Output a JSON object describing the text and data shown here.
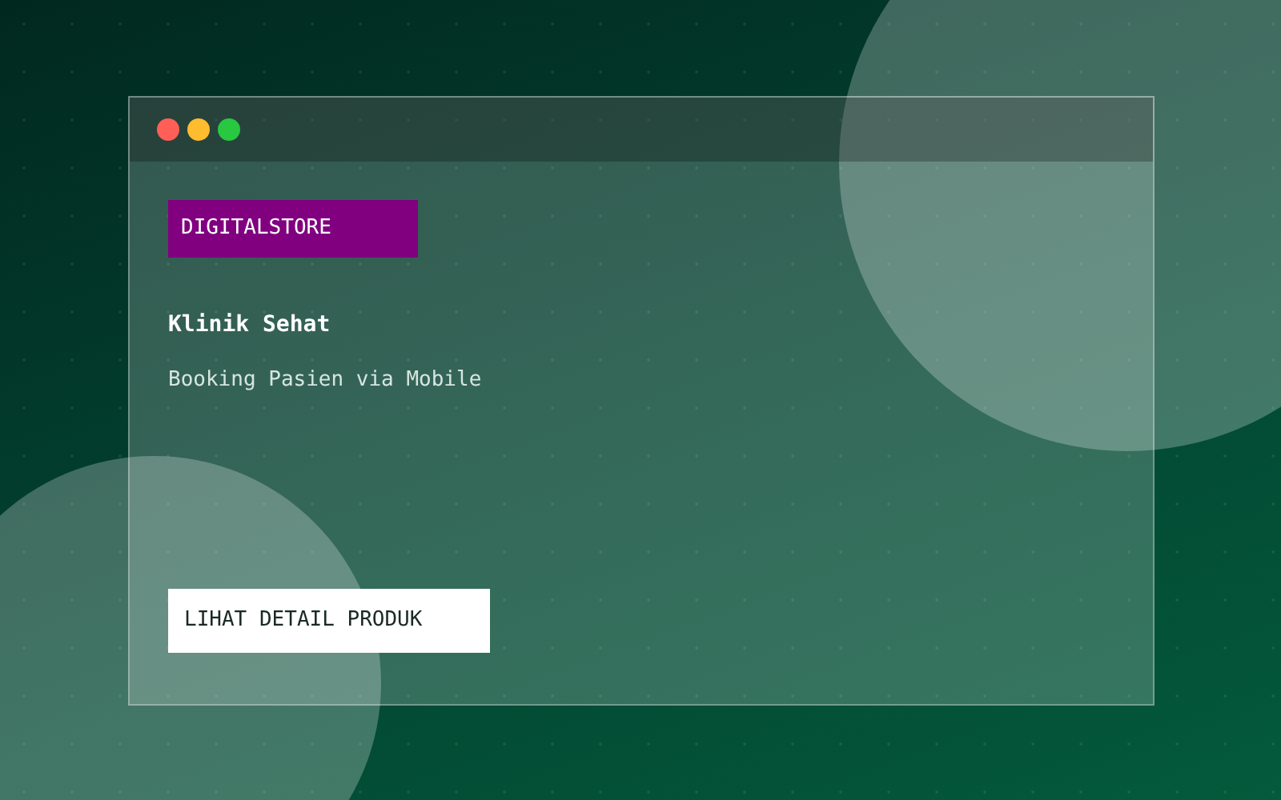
{
  "badge": "DIGITALSTORE",
  "title": "Klinik Sehat",
  "subtitle": "Booking Pasien via Mobile",
  "button": "LIHAT DETAIL PRODUK"
}
